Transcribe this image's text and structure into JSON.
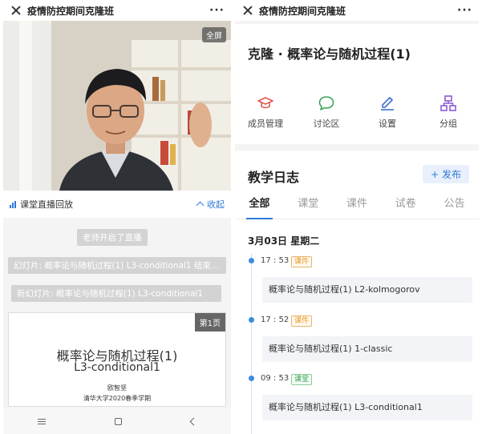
{
  "left": {
    "title": "疫情防控期间克隆班",
    "more": "···",
    "video": {
      "fullscreen_label": "全屏"
    },
    "replay": {
      "title": "课堂直播回放",
      "collapse_label": "收起"
    },
    "messages": [
      "老师开启了直播",
      "幻灯片: 概率论与随机过程(1) L3-conditional1 结束...",
      "新幻灯片: 概率论与随机过程(1) L3-conditional1"
    ],
    "slide": {
      "page_label": "第1页",
      "title_line1": "概率论与随机过程(1)",
      "title_line2": "L3-conditional1",
      "author": "欧智坚",
      "affiliation": "清华大学2020春季学期"
    }
  },
  "right": {
    "title": "疫情防控期间克隆班",
    "more": "···",
    "course_title": "克隆 · 概率论与随机过程(1)",
    "functions": [
      {
        "label": "成员管理",
        "icon": "graduation-cap-icon"
      },
      {
        "label": "讨论区",
        "icon": "chat-bubble-icon"
      },
      {
        "label": "设置",
        "icon": "edit-pen-icon"
      },
      {
        "label": "分组",
        "icon": "group-tree-icon"
      }
    ],
    "log": {
      "header": "教学日志",
      "publish_label": "+ 发布",
      "tabs": [
        "全部",
        "课堂",
        "课件",
        "试卷",
        "公告"
      ],
      "active_tab": 0,
      "date": "3月03日   星期二",
      "entries": [
        {
          "time": "17 : 53",
          "tag": "课件",
          "text": "概率论与随机过程(1) L2-kolmogorov"
        },
        {
          "time": "17 : 52",
          "tag": "课件",
          "text": "概率论与随机过程(1) 1-classic"
        },
        {
          "time": "09 : 53",
          "tag": "课堂",
          "text": "概率论与随机过程(1) L3-conditional1"
        }
      ]
    }
  },
  "colors": {
    "accent": "#2f79d8",
    "icon_red": "#e0584f",
    "icon_green": "#3aa655",
    "icon_blue": "#3b6fd1",
    "icon_purple": "#8a5bd6",
    "tag_orange": "#e79a2a",
    "tag_green": "#3aa655"
  }
}
